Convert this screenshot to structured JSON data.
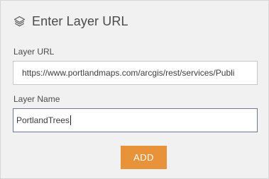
{
  "header": {
    "icon": "layers-icon",
    "title": "Enter Layer URL"
  },
  "form": {
    "layer_url": {
      "label": "Layer URL",
      "value": "https://www.portlandmaps.com/arcgis/rest/services/Publi"
    },
    "layer_name": {
      "label": "Layer Name",
      "value": "PortlandTrees"
    }
  },
  "actions": {
    "add_label": "ADD"
  },
  "colors": {
    "panel_bg": "#f1f1f1",
    "accent_button": "#e8923a",
    "focused_border": "#6a7a92"
  }
}
